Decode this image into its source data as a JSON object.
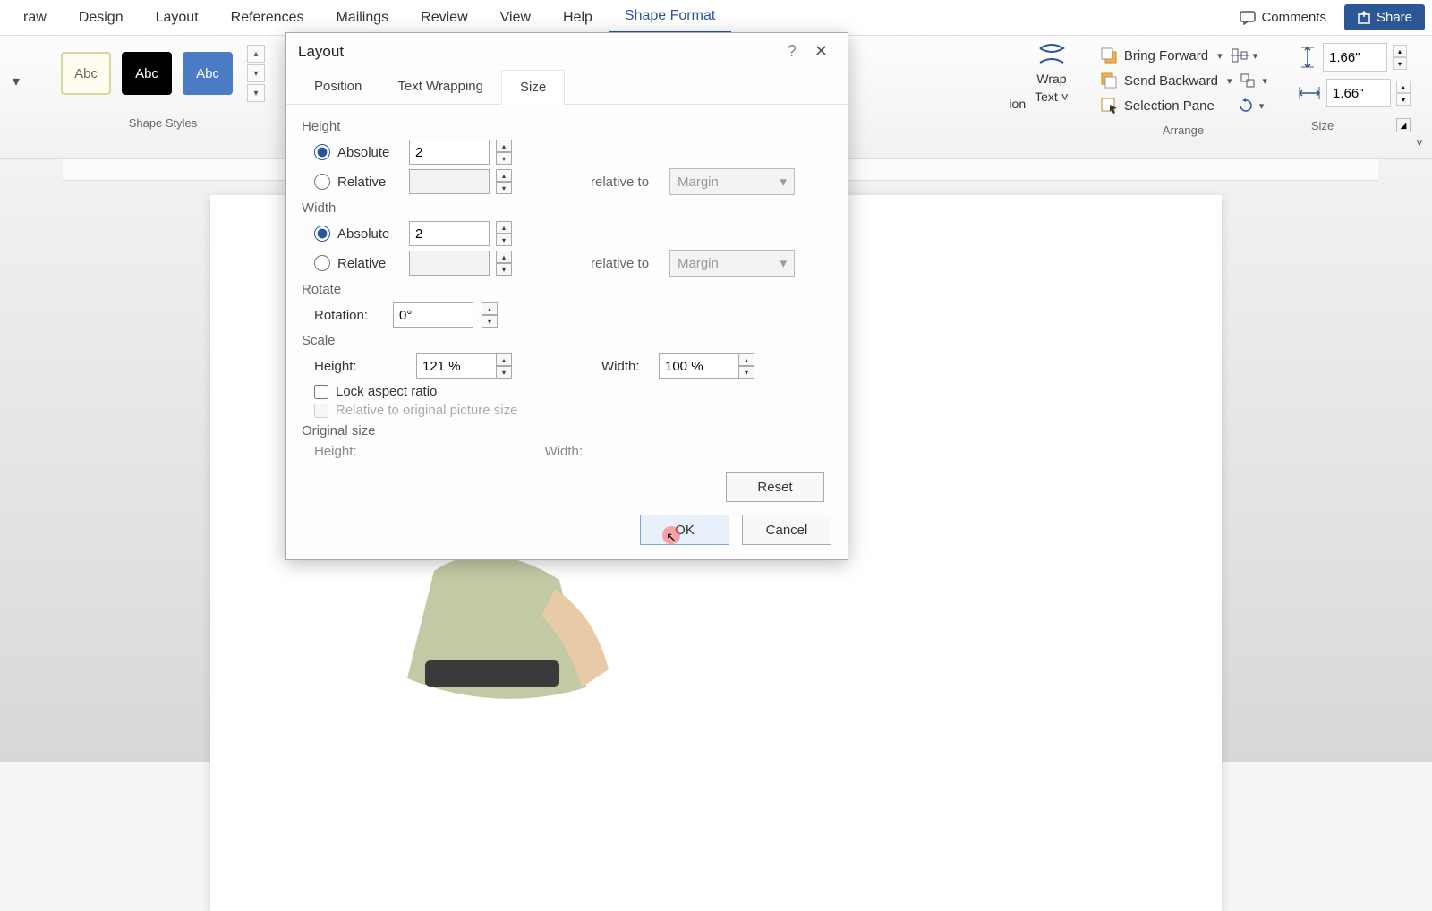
{
  "menubar": {
    "items": [
      "raw",
      "Design",
      "Layout",
      "References",
      "Mailings",
      "Review",
      "View",
      "Help",
      "Shape Format"
    ],
    "active_index": 8,
    "comments_label": "Comments",
    "share_label": "Share"
  },
  "ribbon": {
    "shape_styles": {
      "swatches": [
        "Abc",
        "Abc",
        "Abc"
      ],
      "group_label": "Shape Styles"
    },
    "wrap_text": {
      "line1": "Wrap",
      "line2": "Text"
    },
    "position_fragment": "ion",
    "arrange": {
      "bring_forward": "Bring Forward",
      "send_backward": "Send Backward",
      "selection_pane": "Selection Pane",
      "group_label": "Arrange"
    },
    "size": {
      "height_value": "1.66\"",
      "width_value": "1.66\"",
      "group_label": "Size"
    }
  },
  "dialog": {
    "title": "Layout",
    "tabs": [
      "Position",
      "Text Wrapping",
      "Size"
    ],
    "active_tab_index": 2,
    "height_section": "Height",
    "width_section": "Width",
    "rotate_section": "Rotate",
    "scale_section": "Scale",
    "original_section": "Original size",
    "absolute_label": "Absolute",
    "relative_label": "Relative",
    "relative_to_label": "relative to",
    "rotation_label": "Rotation:",
    "scale_height_label": "Height:",
    "scale_width_label": "Width:",
    "lock_aspect_label": "Lock aspect ratio",
    "relative_pic_label": "Relative to original picture size",
    "orig_height_label": "Height:",
    "orig_width_label": "Width:",
    "height_abs_value": "2",
    "width_abs_value": "2",
    "rotation_value": "0°",
    "scale_height_value": "121 %",
    "scale_width_value": "100 %",
    "margin_option": "Margin",
    "reset_label": "Reset",
    "ok_label": "OK",
    "cancel_label": "Cancel"
  }
}
